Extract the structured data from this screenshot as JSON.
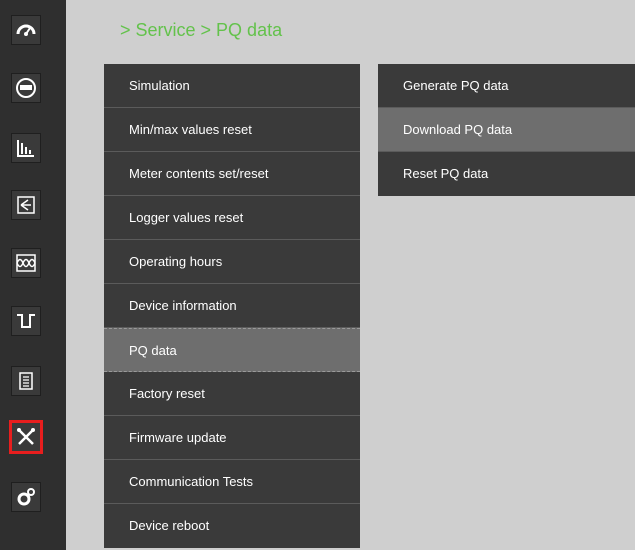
{
  "breadcrumb": "> Service > PQ data",
  "sidebar": {
    "icons": [
      "gauge-icon",
      "meter-icon",
      "bar-chart-icon",
      "phasor-diagram-icon",
      "waveform-icon",
      "signal-dip-icon",
      "logger-list-icon",
      "service-tools-icon",
      "settings-gear-icon"
    ],
    "active": "service-tools-icon",
    "active_color": "#e81e1e"
  },
  "service_menu": {
    "items": [
      {
        "label": "Simulation"
      },
      {
        "label": "Min/max values reset"
      },
      {
        "label": "Meter contents set/reset"
      },
      {
        "label": "Logger values reset"
      },
      {
        "label": "Operating hours"
      },
      {
        "label": "Device information"
      },
      {
        "label": "PQ data"
      },
      {
        "label": "Factory reset"
      },
      {
        "label": "Firmware update"
      },
      {
        "label": "Communication Tests"
      },
      {
        "label": "Device reboot"
      }
    ],
    "selected": "PQ data"
  },
  "pq_submenu": {
    "items": [
      {
        "label": "Generate PQ data"
      },
      {
        "label": "Download PQ data"
      },
      {
        "label": "Reset PQ data"
      }
    ],
    "selected": "Download PQ data"
  },
  "colors": {
    "accent": "#63c24b",
    "menu_bg": "#3a3a3a",
    "selected_bg": "#6e6e6e",
    "sidebar_bg": "#2f2f2f",
    "page_bg": "#cfcfcf"
  }
}
